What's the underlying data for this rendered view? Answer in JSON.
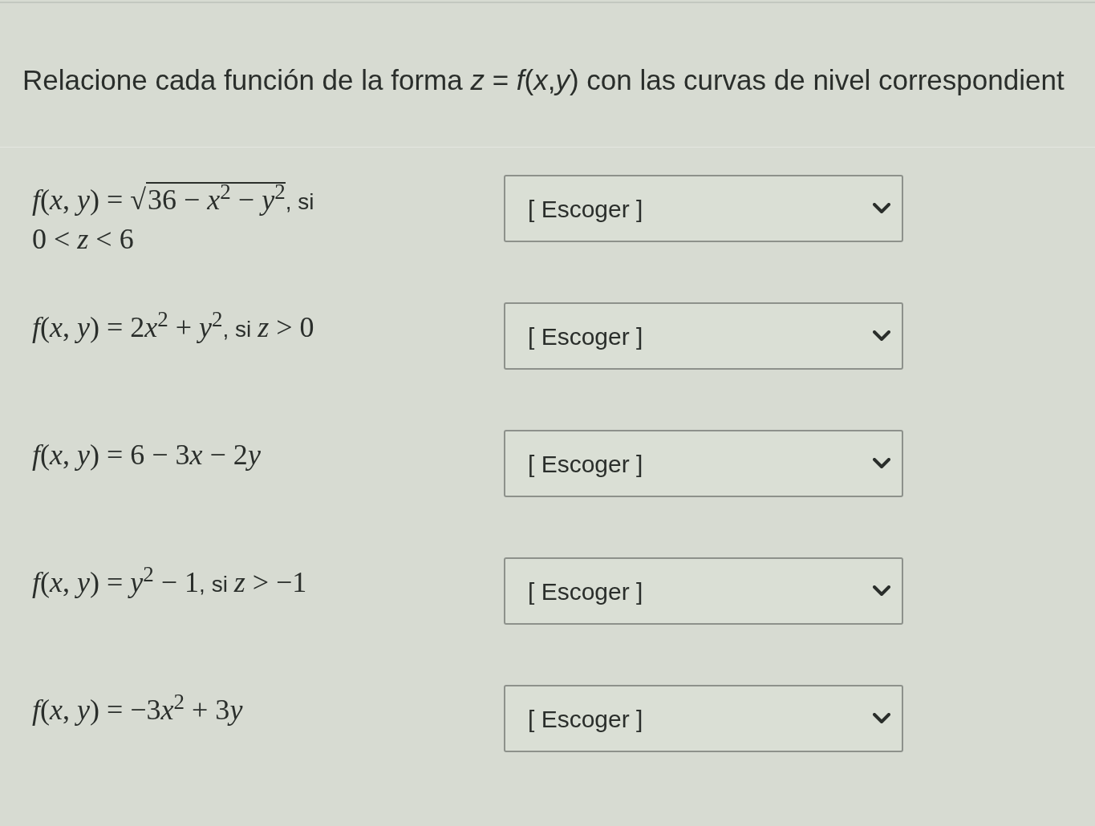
{
  "instructions": "Relacione cada función de la forma *z* = *f*(*x*,*y*) con las curvas de nivel correspondient",
  "items": [
    {
      "formula": [
        [
          {
            "kind": "math",
            "text": "*f*(*x*, *y*) = √"
          },
          {
            "kind": "root",
            "text": "36 − *x*$^{2}$ − *y*$^{2}$"
          },
          {
            "kind": "text",
            "text": ", si"
          }
        ],
        [
          {
            "kind": "math",
            "text": "0 < *z* < 6"
          }
        ]
      ],
      "answer": {
        "value": "[ Escoger ]"
      }
    },
    {
      "formula": [
        [
          {
            "kind": "math",
            "text": "*f*(*x*, *y*) = 2"
          },
          {
            "kind": "math",
            "text": "*x*$^{2}$ + *y*$^{2}$"
          },
          {
            "kind": "text",
            "text": ", si "
          },
          {
            "kind": "math",
            "text": "*z* > 0"
          }
        ]
      ],
      "answer": {
        "value": "[ Escoger ]"
      }
    },
    {
      "formula": [
        [
          {
            "kind": "math",
            "text": "*f*(*x*, *y*) = 6 − 3"
          },
          {
            "kind": "math",
            "text": "*x* − 2"
          },
          {
            "kind": "math",
            "text": "*y*"
          }
        ]
      ],
      "answer": {
        "value": "[ Escoger ]"
      }
    },
    {
      "formula": [
        [
          {
            "kind": "math",
            "text": "*f*(*x*, *y*) = *y*$^{2}$ − 1"
          },
          {
            "kind": "text",
            "text": ", si "
          },
          {
            "kind": "math",
            "text": "*z* > −1"
          }
        ]
      ],
      "answer": {
        "value": "[ Escoger ]"
      }
    },
    {
      "formula": [
        [
          {
            "kind": "math",
            "text": "*f*(*x*, *y*) = −3"
          },
          {
            "kind": "math",
            "text": "*x*$^{2}$ + 3"
          },
          {
            "kind": "math",
            "text": "*y*"
          }
        ]
      ],
      "answer": {
        "value": "[ Escoger ]"
      }
    }
  ]
}
